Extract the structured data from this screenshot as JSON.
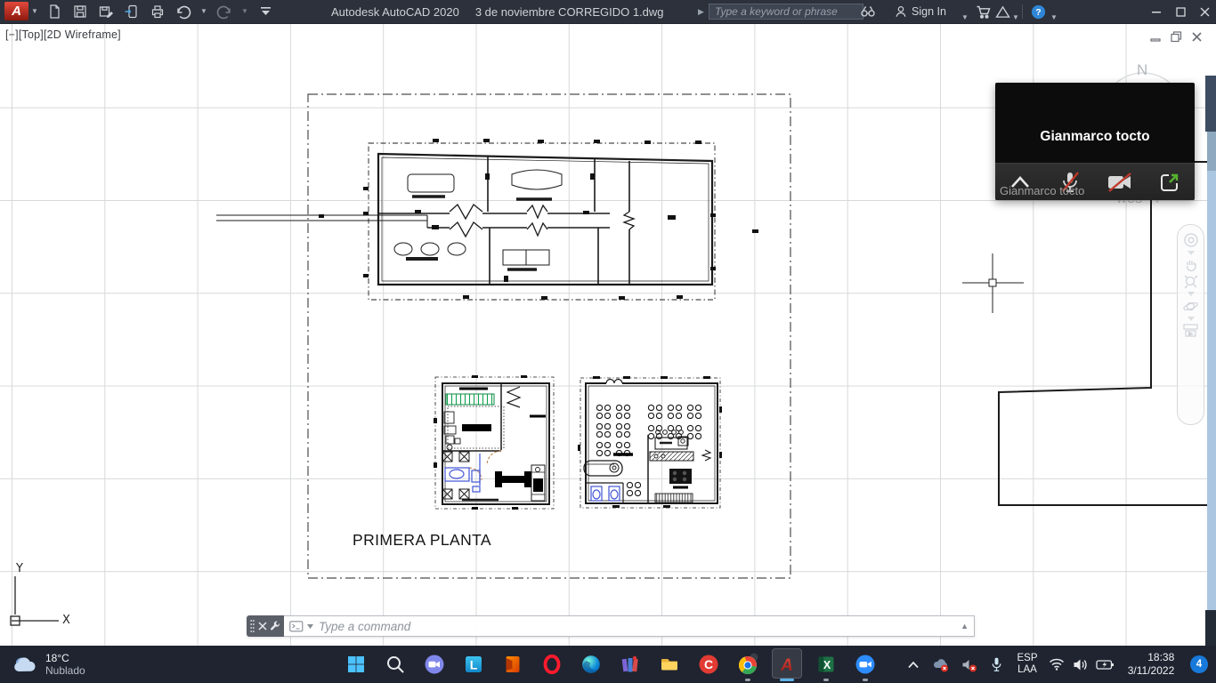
{
  "title_bar": {
    "app_title": "Autodesk AutoCAD 2020",
    "document_title": "3 de noviembre CORREGIDO 1.dwg",
    "search_placeholder": "Type a keyword or phrase",
    "sign_in_label": "Sign In"
  },
  "viewport": {
    "minimize_control": "[−]",
    "view_control": "[Top]",
    "visual_style_control": "[2D Wireframe]",
    "compass_north": "N",
    "ucs_dropdown_label": "WCS",
    "ucs_axis_x": "X",
    "ucs_axis_y": "Y",
    "plan_caption": "PRIMERA PLANTA"
  },
  "command_bar": {
    "placeholder": "Type a command"
  },
  "meeting_overlay": {
    "participant_name": "Gianmarco tocto",
    "window_caption": "Gianmarco tocto"
  },
  "taskbar": {
    "weather": {
      "temperature": "18°C",
      "condition": "Nublado"
    },
    "apps": [
      "start",
      "search",
      "chat",
      "l-app",
      "office",
      "opera",
      "edge",
      "winrar",
      "file-explorer",
      "ccleaner",
      "chrome",
      "autocad",
      "excel",
      "zoom"
    ],
    "running_apps": [
      "chrome",
      "autocad",
      "excel",
      "zoom"
    ],
    "active_app": "autocad",
    "tray": {
      "keyboard_language": "ESP",
      "keyboard_layout": "LAA",
      "time": "18:38",
      "date": "3/11/2022",
      "notification_count": "4"
    }
  },
  "colors": {
    "autocad_brand_red": "#c0392b",
    "taskbar_accent_blue": "#4cc2ff",
    "notification_badge_blue": "#1779d9",
    "muted_control_red": "#c0392b",
    "plan_highlight_green": "#12a150",
    "plan_fixture_blue": "#4053d6"
  }
}
